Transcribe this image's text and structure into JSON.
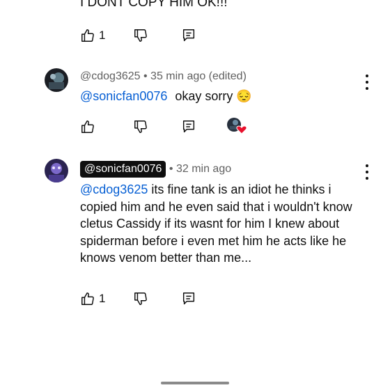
{
  "previous_comment": {
    "text_tail": "I DONT COPY HIM OK!!!",
    "like_count": "1"
  },
  "reply1": {
    "author": "@cdog3625",
    "time": "35 min ago (edited)",
    "mention": "@sonicfan0076",
    "text": "okay sorry",
    "emoji": "😔",
    "avatar_icon": "avatar-dark-icon",
    "heart_badge_icon": "creator-heart-icon"
  },
  "reply2": {
    "author": "@sonicfan0076",
    "time": "32 min ago",
    "mention": "@cdog3625",
    "text": "its fine tank is an idiot he thinks i copied him and he even said that i wouldn't know cletus Cassidy if its wasnt for him I knew about spiderman before i even met him he acts like he knows venom better than me...",
    "like_count": "1",
    "avatar_icon": "avatar-purple-icon"
  },
  "separator": "•",
  "colors": {
    "mention": "#065fd4",
    "meta": "#606060",
    "heart": "#e8112d",
    "chip_bg": "#0f0f0f"
  }
}
